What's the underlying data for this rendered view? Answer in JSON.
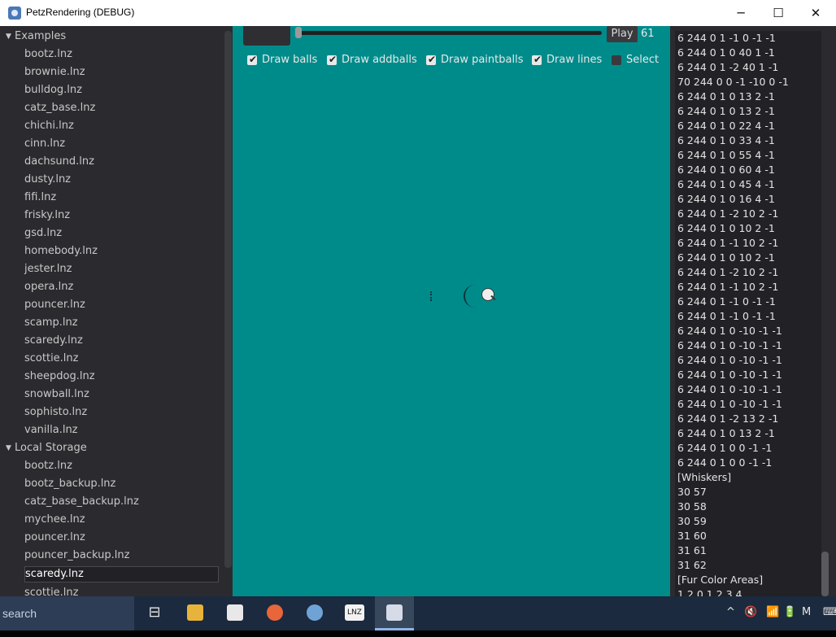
{
  "window": {
    "title": "PetzRendering (DEBUG)",
    "controls": {
      "minimize": "─",
      "maximize": "☐",
      "close": "✕"
    }
  },
  "tree": {
    "sections": [
      {
        "label": "Examples",
        "items": [
          "bootz.lnz",
          "brownie.lnz",
          "bulldog.lnz",
          "catz_base.lnz",
          "chichi.lnz",
          "cinn.lnz",
          "dachsund.lnz",
          "dusty.lnz",
          "fifi.lnz",
          "frisky.lnz",
          "gsd.lnz",
          "homebody.lnz",
          "jester.lnz",
          "opera.lnz",
          "pouncer.lnz",
          "scamp.lnz",
          "scaredy.lnz",
          "scottie.lnz",
          "sheepdog.lnz",
          "snowball.lnz",
          "sophisto.lnz",
          "vanilla.lnz"
        ]
      },
      {
        "label": "Local Storage",
        "items": [
          "bootz.lnz",
          "bootz_backup.lnz",
          "catz_base_backup.lnz",
          "mychee.lnz",
          "pouncer.lnz",
          "pouncer_backup.lnz",
          "scaredy.lnz",
          "scottie.lnz"
        ],
        "selected": "scaredy.lnz"
      }
    ]
  },
  "viewer": {
    "play_label": "Play",
    "frame": "61",
    "options": [
      {
        "label": "Draw balls",
        "checked": true
      },
      {
        "label": "Draw addballs",
        "checked": true
      },
      {
        "label": "Draw paintballs",
        "checked": true
      },
      {
        "label": "Draw lines",
        "checked": true
      },
      {
        "label": "Select",
        "checked": false
      }
    ],
    "background_color": "#008b8b"
  },
  "text_panel": {
    "lines": [
      "6 244 0 1 -1 0 -1 -1",
      "6 244 0 1 0 40 1 -1",
      "6 244 0 1 -2 40 1 -1",
      "70 244 0 0 -1 -10 0 -1",
      "6 244 0 1 0 13 2 -1",
      "6 244 0 1 0 13 2 -1",
      "6 244 0 1 0 22 4 -1",
      "6 244 0 1 0 33 4 -1",
      "6 244 0 1 0 55 4 -1",
      "6 244 0 1 0 60 4 -1",
      "6 244 0 1 0 45 4 -1",
      "6 244 0 1 0 16 4 -1",
      "6 244 0 1 -2 10 2 -1",
      "6 244 0 1 0 10 2 -1",
      "6 244 0 1 -1 10 2 -1",
      "6 244 0 1 0 10 2 -1",
      "6 244 0 1 -2 10 2 -1",
      "6 244 0 1 -1 10 2 -1",
      "6 244 0 1 -1 0 -1 -1",
      "6 244 0 1 -1 0 -1 -1",
      "6 244 0 1 0 -10 -1 -1",
      "6 244 0 1 0 -10 -1 -1",
      "6 244 0 1 0 -10 -1 -1",
      "6 244 0 1 0 -10 -1 -1",
      "6 244 0 1 0 -10 -1 -1",
      "6 244 0 1 0 -10 -1 -1",
      "6 244 0 1 -2 13 2 -1",
      "6 244 0 1 0 13 2 -1",
      "6 244 0 1 0 0 -1 -1",
      "6 244 0 1 0 0 -1 -1",
      "[Whiskers]",
      "30 57",
      "30 58",
      "30 59",
      "31 60",
      "31 61",
      "31 62",
      "[Fur Color Areas]",
      "1 2 0 1 2 3 4"
    ]
  },
  "taskbar": {
    "search": "search",
    "apps": [
      {
        "name": "task-view-icon",
        "glyph": "⊟"
      },
      {
        "name": "file-explorer-icon",
        "color": "#e8b33a"
      },
      {
        "name": "notepad-icon",
        "color": "#e8e8e8"
      },
      {
        "name": "firefox-icon",
        "color": "#e8663a"
      },
      {
        "name": "godot-icon",
        "color": "#6fa3d6"
      },
      {
        "name": "lnz-app-icon",
        "label": "LNZ"
      },
      {
        "name": "petz-rendering-icon",
        "color": "#d6dbe8"
      }
    ],
    "tray": [
      "^",
      "🔇",
      "📶",
      "🔋",
      "M",
      "⌨"
    ]
  }
}
